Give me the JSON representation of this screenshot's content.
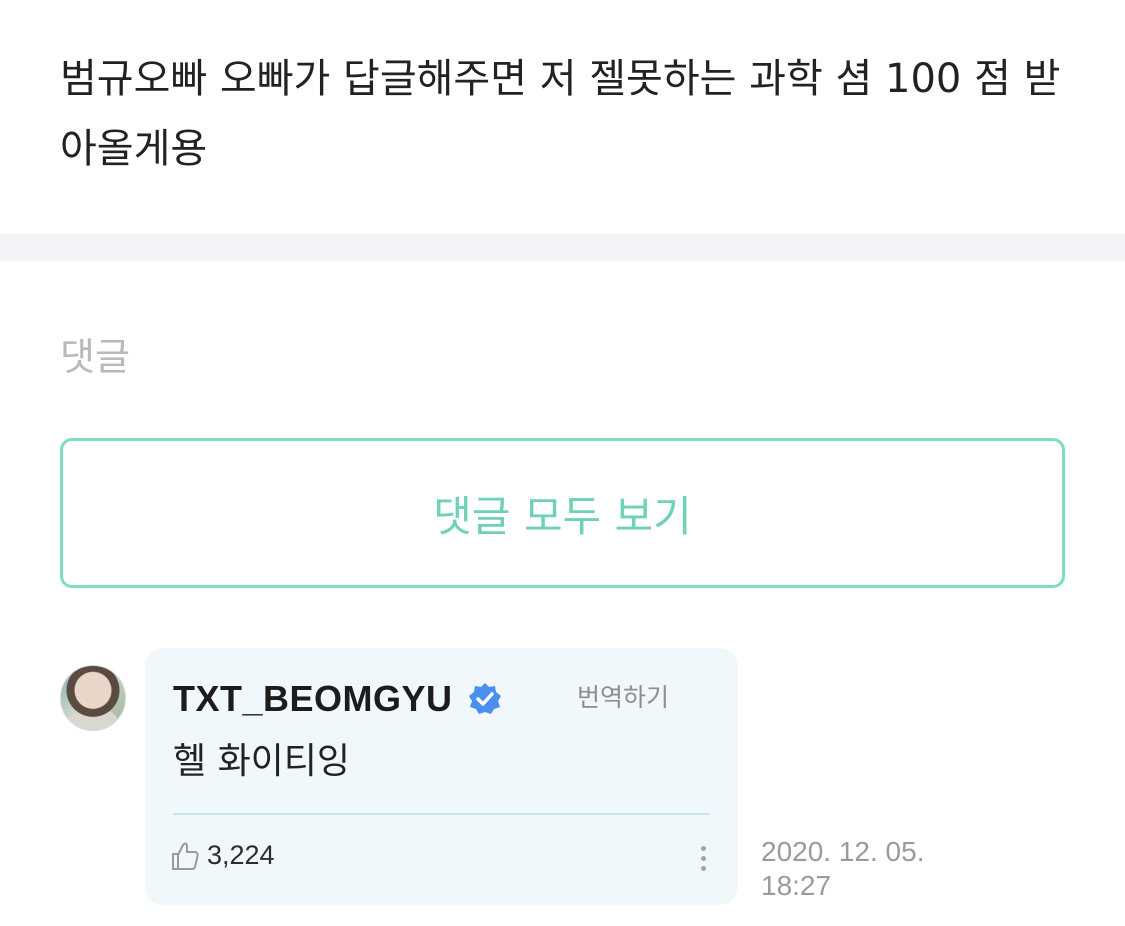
{
  "post": {
    "text": "범규오빠 오빠가 답글해주면 저 젤못하는 과학 셤 100 점 받아올게용"
  },
  "comments": {
    "section_title": "댓글",
    "view_all_label": "댓글 모두 보기"
  },
  "comment": {
    "author": "TXT_BEOMGYU",
    "verified": true,
    "translate_label": "번역하기",
    "body": "헬 화이티잉",
    "likes": "3,224",
    "date": "2020. 12. 05.",
    "time": "18:27"
  },
  "colors": {
    "accent_mint": "#6fd2b8",
    "verified_blue": "#4a8ef0",
    "bubble_bg": "#f1f8fb"
  },
  "icons": [
    "verified-badge-icon",
    "thumbs-up-icon",
    "more-vertical-icon"
  ]
}
